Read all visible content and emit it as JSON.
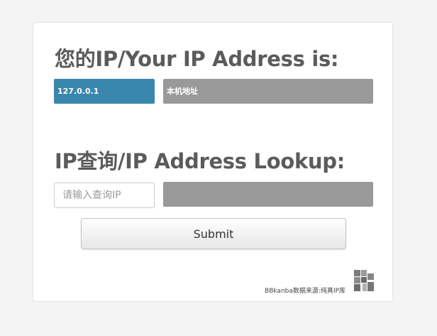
{
  "your_ip": {
    "heading": "您的IP/Your IP Address is:",
    "ip_value": "127.0.0.1",
    "location_value": "本机地址"
  },
  "lookup": {
    "heading": "IP查询/IP Address Lookup:",
    "input_placeholder": "请输入查询IP",
    "input_value": "",
    "result_value": "",
    "submit_label": "Submit"
  },
  "footer": {
    "source_text": "BBkanba数据来源:纯真IP库",
    "logo_icon": "bbkanba-logo-icon"
  },
  "colors": {
    "ip_badge": "#3a87ad",
    "gray_badge": "#999999",
    "heading_text": "#5b5b5b"
  }
}
